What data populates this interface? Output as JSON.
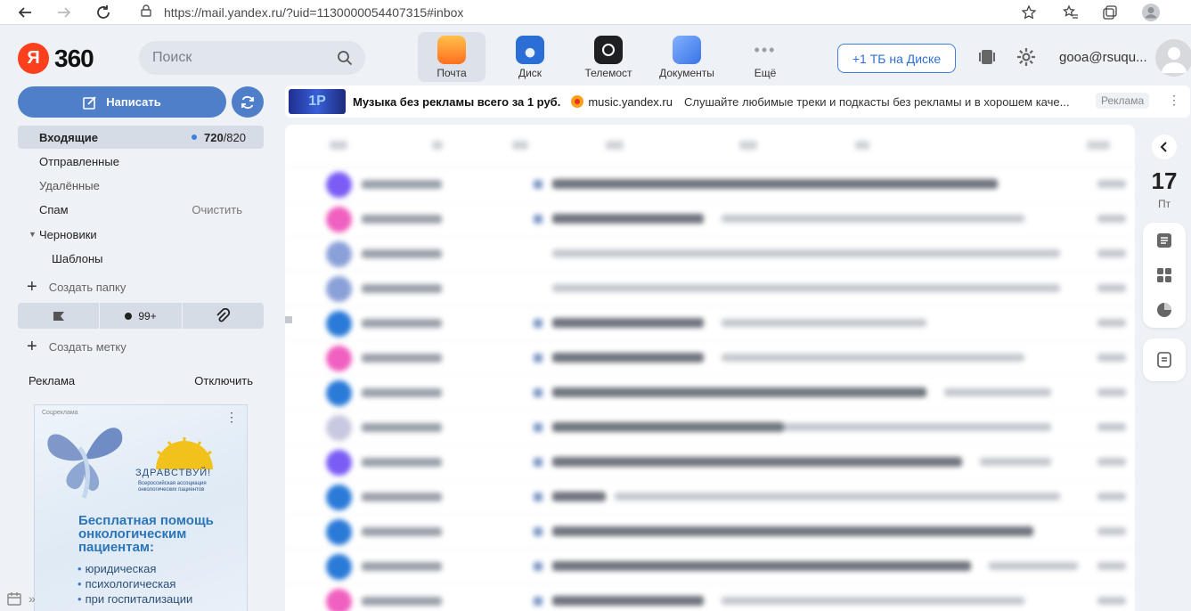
{
  "browser": {
    "url": "https://mail.yandex.ru/?uid=1130000054407315#inbox"
  },
  "header": {
    "logo_letter": "Я",
    "logo_text": "360",
    "search_placeholder": "Поиск",
    "services": [
      {
        "label": "Почта",
        "icon": "mail-icon",
        "color": "#ff8a2a",
        "active": true
      },
      {
        "label": "Диск",
        "icon": "disk-icon",
        "color": "#2b6ed6",
        "active": false
      },
      {
        "label": "Телемост",
        "icon": "telemost-icon",
        "color": "#1d1f23",
        "active": false
      },
      {
        "label": "Документы",
        "icon": "documents-icon",
        "color": "#4f8df0",
        "active": false
      },
      {
        "label": "Ещё",
        "icon": "more-icon",
        "color": "#9aa0aa",
        "active": false
      }
    ],
    "disk_offer": "+1 ТБ на Диске",
    "user_email": "gooa@rsuqu..."
  },
  "sidebar": {
    "compose_label": "Написать",
    "folders": [
      {
        "label": "Входящие",
        "unread": "720",
        "total": "/820",
        "active": true
      },
      {
        "label": "Отправленные"
      },
      {
        "label": "Удалённые"
      },
      {
        "label": "Спам",
        "action": "Очистить"
      },
      {
        "label": "Черновики",
        "expanded": true
      },
      {
        "label": "Шаблоны"
      }
    ],
    "create_folder": "Создать папку",
    "labels": {
      "unread_count": "99+"
    },
    "create_label": "Создать метку",
    "ad_title": "Реклама",
    "ad_disable": "Отключить",
    "ad": {
      "small_label": "Соцреклама",
      "brand": "ЗДРАВСТВУЙ!",
      "brand_sub": "Всероссийская ассоциация онкологических пациентов",
      "headline": "Бесплатная помощь онкологическим пациентам:",
      "items": [
        "юридическая",
        "психологическая",
        "при госпитализации"
      ]
    }
  },
  "promo": {
    "title": "Музыка без рекламы всего за 1 руб.",
    "site": "music.yandex.ru",
    "description": "Слушайте любимые треки и подкасты без рекламы и в хорошем каче...",
    "tag": "Реклама"
  },
  "calendar": {
    "day": "17",
    "weekday": "Пт"
  },
  "colors": {
    "accent": "#4f7fc9",
    "brand_red": "#fc3f1d"
  }
}
